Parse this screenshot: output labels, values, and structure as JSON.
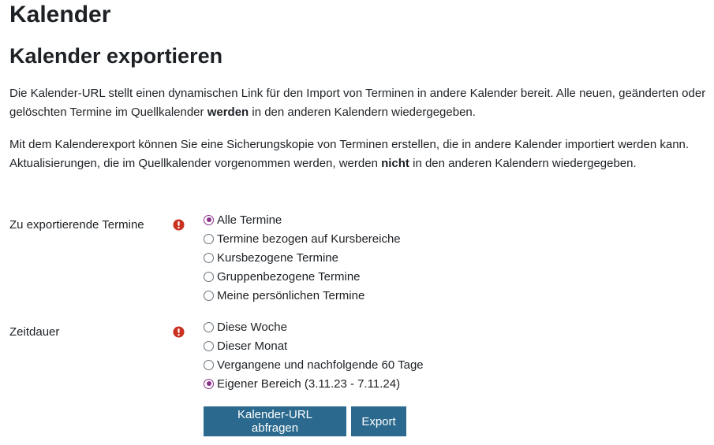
{
  "page": {
    "title": "Kalender",
    "heading": "Kalender exportieren"
  },
  "intro": {
    "p1_before": "Die Kalender-URL stellt einen dynamischen Link für den Import von Terminen in andere Kalender bereit. Alle neuen, geänderten oder gelöschten Termine im Quellkalender ",
    "p1_bold": "werden",
    "p1_after": " in den anderen Kalendern wiedergegeben.",
    "p2_before": "Mit dem Kalenderexport können Sie eine Sicherungskopie von Terminen erstellen, die in andere Kalender importiert werden kann. Aktualisierungen, die im Quellkalender vorgenommen werden, werden ",
    "p2_bold": "nicht",
    "p2_after": " in den anderen Kalendern wiedergegeben."
  },
  "events": {
    "label": "Zu exportierende Termine",
    "required_icon": "exclamation-circle-icon",
    "options": [
      {
        "label": "Alle Termine",
        "checked": true
      },
      {
        "label": "Termine bezogen auf Kursbereiche",
        "checked": false
      },
      {
        "label": "Kursbezogene Termine",
        "checked": false
      },
      {
        "label": "Gruppenbezogene Termine",
        "checked": false
      },
      {
        "label": "Meine persönlichen Termine",
        "checked": false
      }
    ]
  },
  "period": {
    "label": "Zeitdauer",
    "required_icon": "exclamation-circle-icon",
    "options": [
      {
        "label": "Diese Woche",
        "checked": false
      },
      {
        "label": "Dieser Monat",
        "checked": false
      },
      {
        "label": "Vergangene und nachfolgende 60 Tage",
        "checked": false
      },
      {
        "label": "Eigener Bereich (3.11.23 - 7.11.24)",
        "checked": true
      }
    ]
  },
  "buttons": {
    "get_url": "Kalender-URL abfragen",
    "export": "Export"
  },
  "colors": {
    "accent": "#8b2f8c",
    "button": "#2b6a8e",
    "required": "#ca3120"
  }
}
